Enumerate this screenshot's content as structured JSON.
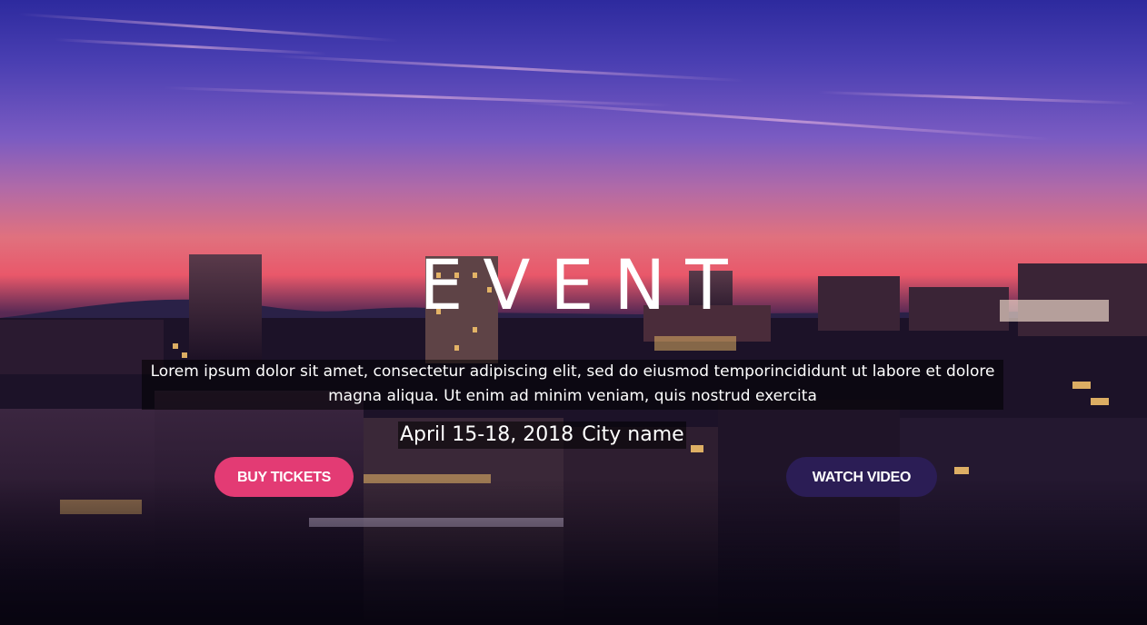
{
  "hero": {
    "title": "EVENT",
    "description": "Lorem ipsum dolor sit amet, consectetur adipiscing elit, sed do eiusmod temporincididunt ut labore et dolore magna aliqua. Ut enim ad minim veniam, quis nostrud exercita",
    "date": "April 15-18, 2018",
    "city": "City name",
    "background_image": "city-skyline-at-dusk"
  },
  "actions": {
    "buy_tickets_label": "BUY TICKETS",
    "watch_video_label": "WATCH VIDEO"
  },
  "colors": {
    "buy_button": "#e33b74",
    "watch_button": "#2b1d55",
    "text": "#ffffff"
  }
}
